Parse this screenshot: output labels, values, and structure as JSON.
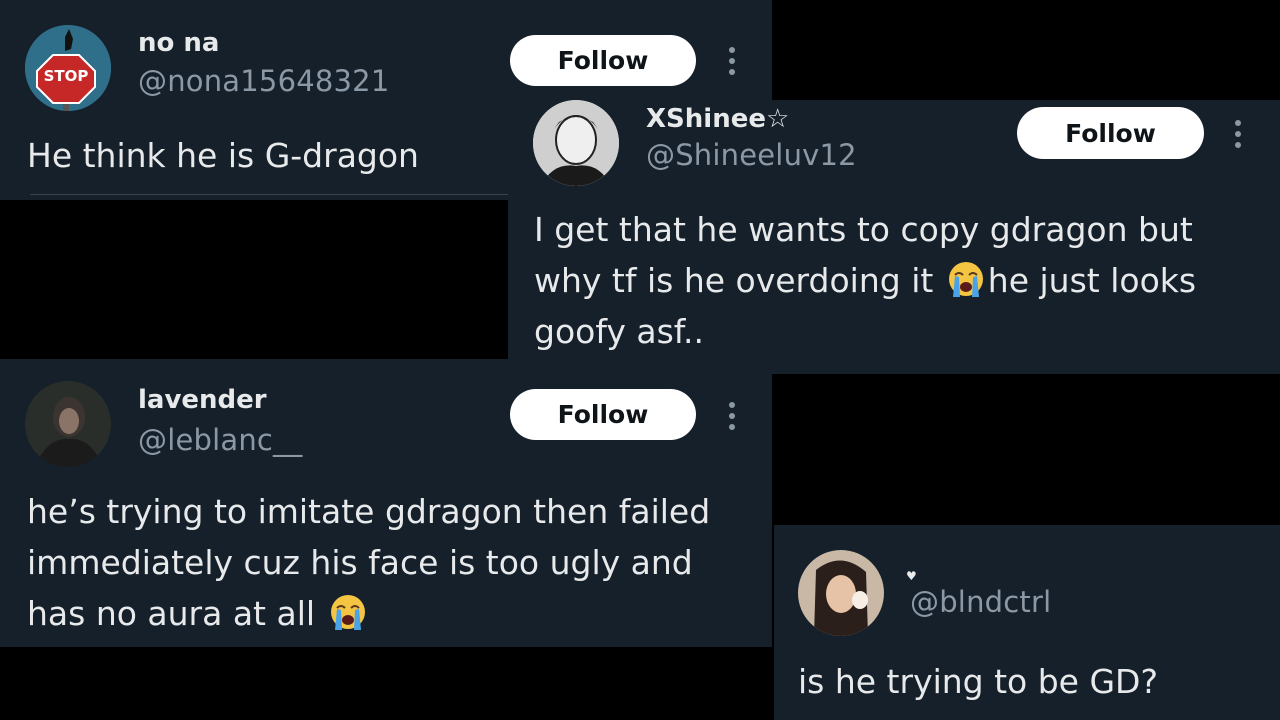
{
  "tweets": [
    {
      "display_name": "no na",
      "handle": "@nona15648321",
      "follow_label": "Follow",
      "text": "He think he is G-dragon",
      "avatar_sign": "STOP"
    },
    {
      "display_name": "XShinee☆",
      "handle": "@Shineeluv12",
      "follow_label": "Follow",
      "text_line1": "I get that he wants to copy gdragon but",
      "text_line2a": "why tf is he overdoing it ",
      "text_line2b": "he just looks",
      "text_line3": "goofy asf.."
    },
    {
      "display_name": "lavender",
      "handle": "@leblanc__",
      "follow_label": "Follow",
      "text_line1": "he’s trying to imitate gdragon then failed",
      "text_line2": "immediately cuz his face is too ugly and",
      "text_line3": "has no aura at all "
    },
    {
      "display_name": "♥",
      "handle": "@blndctrl",
      "text": "is he trying to be GD?"
    }
  ],
  "colors": {
    "card_background": "#15202b",
    "page_background": "#000000",
    "primary_text": "#e7e9ea",
    "secondary_text": "#8b98a5",
    "follow_button_bg": "#ffffff",
    "follow_button_text": "#0f1419"
  },
  "icons": [
    "more-vertical-icon",
    "loudly-crying-face-emoji"
  ]
}
